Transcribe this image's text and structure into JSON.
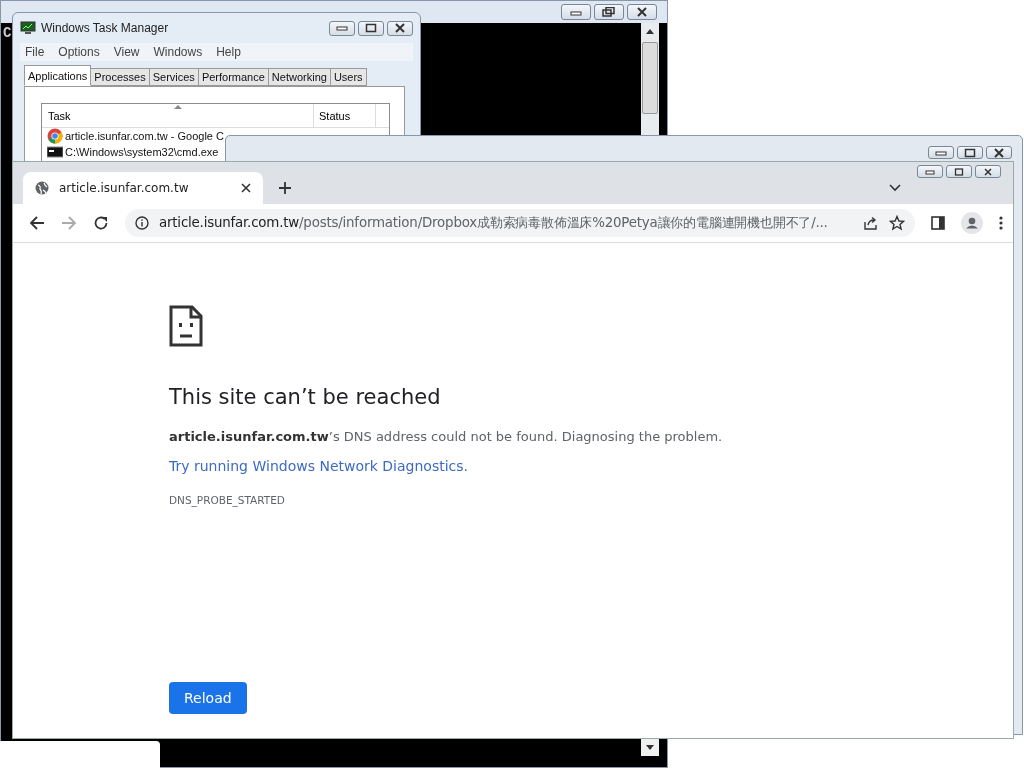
{
  "console_window": {
    "console_text": "C"
  },
  "task_manager": {
    "title": "Windows Task Manager",
    "menu": [
      "File",
      "Options",
      "View",
      "Windows",
      "Help"
    ],
    "tabs": [
      {
        "label": "Applications",
        "selected": true
      },
      {
        "label": "Processes",
        "selected": false
      },
      {
        "label": "Services",
        "selected": false
      },
      {
        "label": "Performance",
        "selected": false
      },
      {
        "label": "Networking",
        "selected": false
      },
      {
        "label": "Users",
        "selected": false
      }
    ],
    "columns": [
      "Task",
      "Status"
    ],
    "rows": [
      {
        "task": "article.isunfar.com.tw - Google C",
        "kind": "browser"
      },
      {
        "task": "C:\\Windows\\system32\\cmd.exe",
        "kind": "console"
      }
    ]
  },
  "browser": {
    "tabs": [
      {
        "title": "article.isunfar.com.tw",
        "selected": true
      }
    ],
    "url_host": "article.isunfar.com.tw",
    "url_rest": "/posts/information/Dropbox成勒索病毒散佈溫床%20Petya讓你的電腦連開機也開不了/...",
    "error": {
      "heading": "This site can’t be reached",
      "message": "**article.isunfar.com.tw**’s DNS address could not be found. Diagnosing the problem.",
      "link": "Try running Windows Network Diagnostics.",
      "code": "DNS_PROBE_STARTED",
      "reload": "Reload"
    }
  }
}
